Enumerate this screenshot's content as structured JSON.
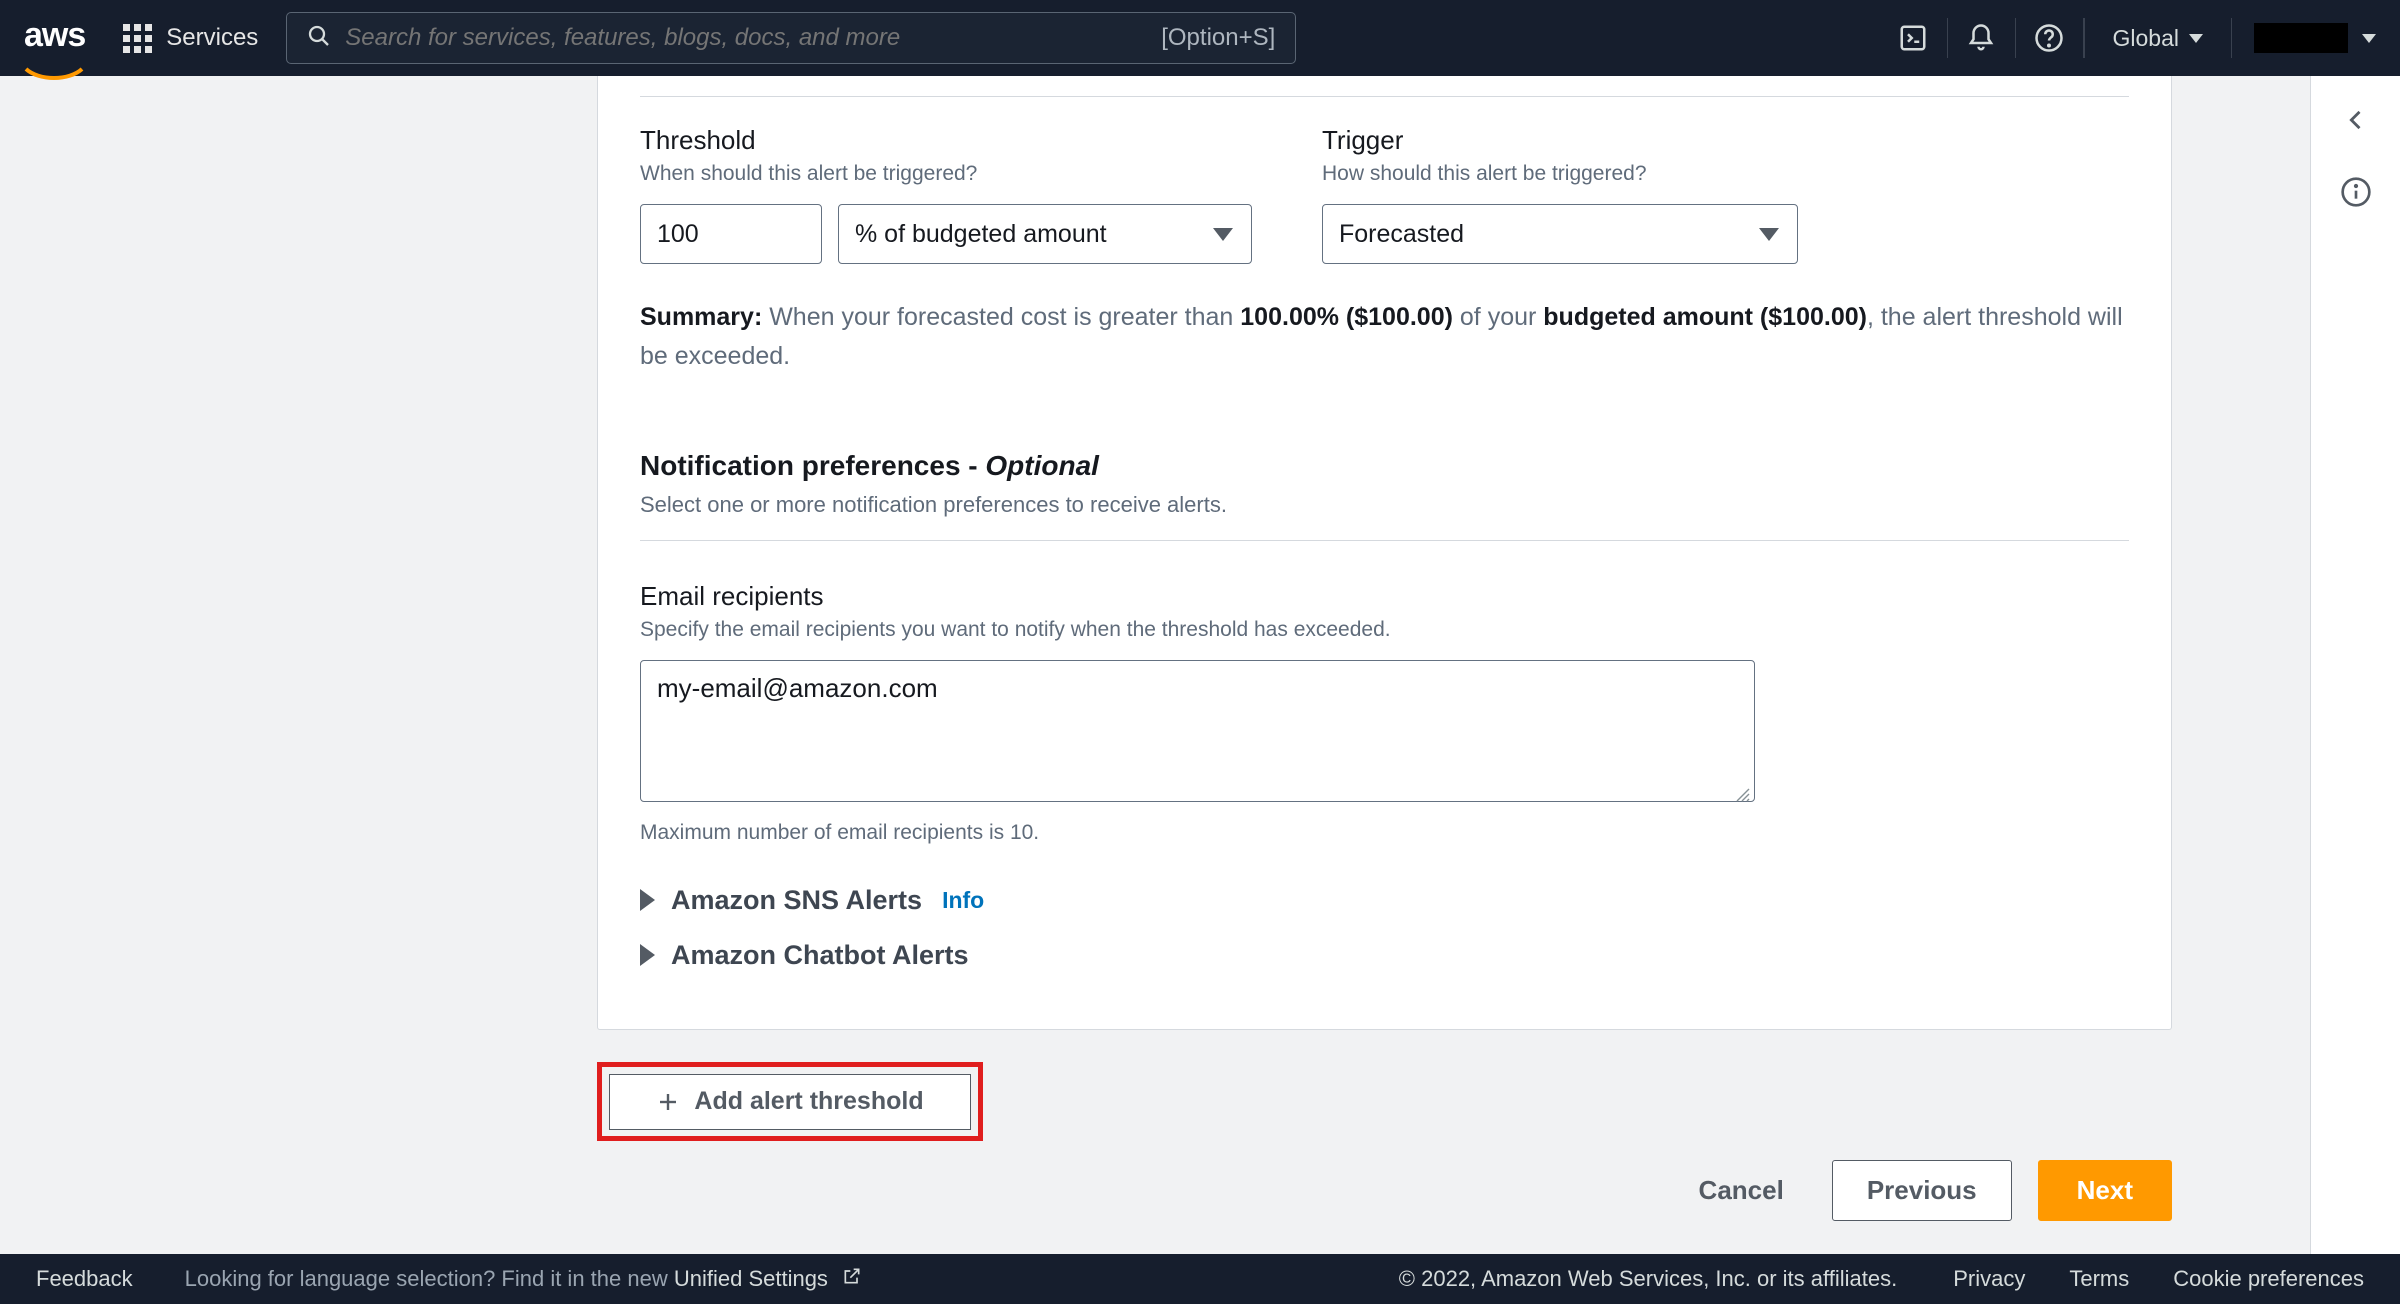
{
  "nav": {
    "logo": "aws",
    "services_label": "Services",
    "search_placeholder": "Search for services, features, blogs, docs, and more",
    "search_hotkey": "[Option+S]",
    "region": "Global"
  },
  "threshold": {
    "label": "Threshold",
    "sub": "When should this alert be triggered?",
    "value": "100",
    "unit": "% of budgeted amount"
  },
  "trigger": {
    "label": "Trigger",
    "sub": "How should this alert be triggered?",
    "value": "Forecasted"
  },
  "summary": {
    "prefix": "Summary:",
    "t1": " When your forecasted cost is greater than ",
    "pct": "100.00% ($100.00)",
    "t2": " of your ",
    "budget": "budgeted amount ($100.00)",
    "t3": ", the alert threshold will be exceeded."
  },
  "notif_prefs": {
    "title": "Notification preferences - ",
    "optional": "Optional",
    "sub": "Select one or more notification preferences to receive alerts."
  },
  "email": {
    "label": "Email recipients",
    "sub": "Specify the email recipients you want to notify when the threshold has exceeded.",
    "value": "my-email@amazon.com",
    "note": "Maximum number of email recipients is 10."
  },
  "expanders": {
    "sns": "Amazon SNS Alerts",
    "sns_info": "Info",
    "chatbot": "Amazon Chatbot Alerts"
  },
  "add_threshold": "Add alert threshold",
  "wizard": {
    "cancel": "Cancel",
    "previous": "Previous",
    "next": "Next"
  },
  "footer": {
    "feedback": "Feedback",
    "lang_prompt": "Looking for language selection? Find it in the new ",
    "lang_link": "Unified Settings",
    "copyright": "© 2022, Amazon Web Services, Inc. or its affiliates.",
    "privacy": "Privacy",
    "terms": "Terms",
    "cookies": "Cookie preferences"
  }
}
